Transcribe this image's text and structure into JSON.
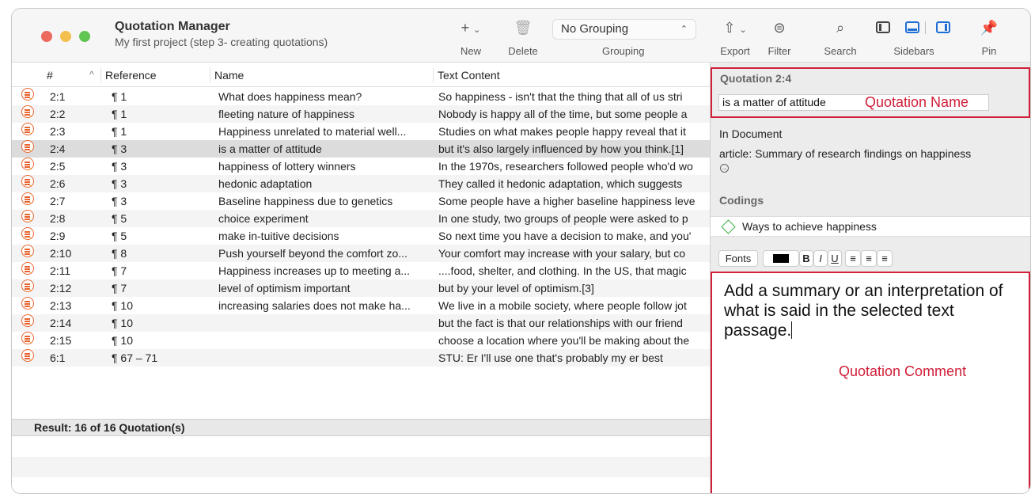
{
  "window": {
    "title": "Quotation Manager",
    "subtitle": "My first project (step 3- creating quotations)"
  },
  "toolbar": {
    "new_label": "New",
    "delete_label": "Delete",
    "grouping_value": "No Grouping",
    "grouping_label": "Grouping",
    "export_label": "Export",
    "filter_label": "Filter",
    "search_label": "Search",
    "sidebars_label": "Sidebars",
    "pin_label": "Pin",
    "icons": {
      "new": "plus-icon",
      "delete": "trash-icon",
      "export": "share-icon",
      "filter": "filter-icon",
      "search": "search-icon",
      "pin": "pin-icon"
    }
  },
  "table": {
    "columns": {
      "num": "#",
      "reference": "Reference",
      "name": "Name",
      "text": "Text Content"
    },
    "sort_indicator": "^",
    "rows": [
      {
        "num": "2:1",
        "ref": "¶ 1",
        "name": "What does happiness mean?",
        "text": "So happiness - isn't that the thing that all of us stri"
      },
      {
        "num": "2:2",
        "ref": "¶ 1",
        "name": "fleeting nature of happiness",
        "text": "Nobody is happy all of the time, but some people a"
      },
      {
        "num": "2:3",
        "ref": "¶ 1",
        "name": "Happiness unrelated to material well...",
        "text": "Studies on what makes people happy reveal that it"
      },
      {
        "num": "2:4",
        "ref": "¶ 3",
        "name": "is a matter of attitude",
        "text": "but it's also largely influenced by how you think.[1]"
      },
      {
        "num": "2:5",
        "ref": "¶ 3",
        "name": "happiness of lottery winners",
        "text": "In the 1970s, researchers followed people who'd wo"
      },
      {
        "num": "2:6",
        "ref": "¶ 3",
        "name": "hedonic adaptation",
        "text": "They called it hedonic adaptation, which suggests"
      },
      {
        "num": "2:7",
        "ref": "¶ 3",
        "name": "Baseline happiness due to genetics",
        "text": "Some people have a higher baseline happiness leve"
      },
      {
        "num": "2:8",
        "ref": "¶ 5",
        "name": "choice experiment",
        "text": "In one study, two groups of people were asked to p"
      },
      {
        "num": "2:9",
        "ref": "¶ 5",
        "name": "make in-tuitive decisions",
        "text": "So next time you have a decision to make, and you'"
      },
      {
        "num": "2:10",
        "ref": "¶ 8",
        "name": "Push yourself beyond the comfort zo...",
        "text": "Your comfort may increase with your salary, but co"
      },
      {
        "num": "2:11",
        "ref": "¶ 7",
        "name": "Happiness increases up to meeting a...",
        "text": "....food, shelter, and clothing. In the US, that magic"
      },
      {
        "num": "2:12",
        "ref": "¶ 7",
        "name": "level of optimism important",
        "text": "but by your level of optimism.[3]"
      },
      {
        "num": "2:13",
        "ref": "¶ 10",
        "name": "increasing salaries does not make ha...",
        "text": "We live in a mobile society, where people follow jot"
      },
      {
        "num": "2:14",
        "ref": "¶ 10",
        "name": "",
        "text": "but the fact is that our relationships with our friend"
      },
      {
        "num": "2:15",
        "ref": "¶ 10",
        "name": "",
        "text": "choose a location where you'll be making about the"
      },
      {
        "num": "6:1",
        "ref": "¶ 67 – 71",
        "name": "",
        "text": "STU:      Er I'll use one that's probably my er best"
      }
    ],
    "selected_index": 3,
    "result": "Result: 16 of 16 Quotation(s)"
  },
  "sidebar": {
    "title": "Quotation 2:4",
    "name_value": "is a matter of attitude",
    "name_annotation": "Quotation Name",
    "in_document_label": "In Document",
    "document_name": "article: Summary of research findings on happiness",
    "codings_label": "Codings",
    "codes": [
      "Ways to achieve happiness"
    ],
    "format_bar": {
      "fonts": "Fonts",
      "bold": "B",
      "italic": "I",
      "underline": "U",
      "text_color": "#000000"
    },
    "comment_text": "Add a summary or an interpretation of what is said in the selected text passage.",
    "comment_annotation": "Quotation Comment"
  },
  "colors": {
    "annotation_red": "#d0203a",
    "accent_blue": "#1f6fd6",
    "quotation_orange": "#e8632f",
    "code_green": "#3fae4a"
  }
}
